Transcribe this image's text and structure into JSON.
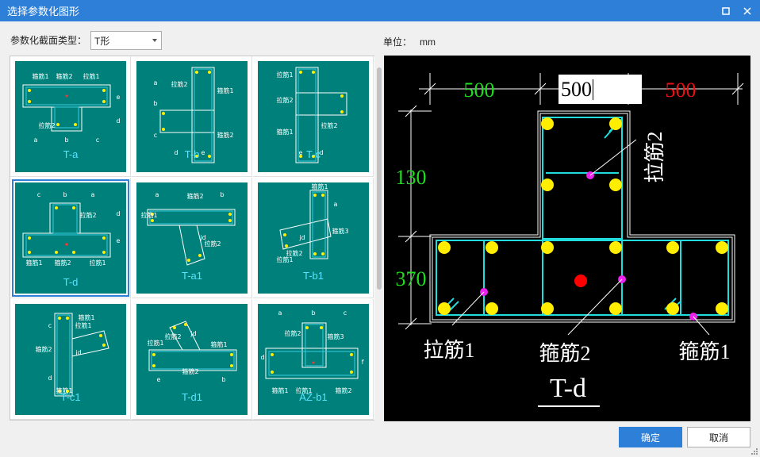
{
  "window": {
    "title": "选择参数化图形"
  },
  "controls": {
    "section_type_label": "参数化截面类型：",
    "section_type_value": "T形",
    "unit_label": "单位：",
    "unit_value": "mm"
  },
  "gallery": {
    "items": [
      {
        "label": "T-a"
      },
      {
        "label": "T-b"
      },
      {
        "label": "T-c"
      },
      {
        "label": "T-d"
      },
      {
        "label": "T-a1"
      },
      {
        "label": "T-b1"
      },
      {
        "label": "T-c1"
      },
      {
        "label": "T-d1"
      },
      {
        "label": "AZ-b1"
      }
    ],
    "selected": "T-d",
    "thumb_text": {
      "gujin1": "箍筋1",
      "gujin2": "箍筋2",
      "lajin1": "拉筋1",
      "lajin2": "拉筋2",
      "gujin3": "箍筋3",
      "jd": "jd",
      "a": "a",
      "b": "b",
      "c": "c",
      "d": "d",
      "e": "e",
      "f": "f"
    }
  },
  "preview": {
    "dim_left": "500",
    "dim_input": "500",
    "dim_right": "500",
    "dim_top": "130",
    "dim_bottom": "370",
    "label_lajin2": "拉筋2",
    "label_lajin1": "拉筋1",
    "label_gujin2": "箍筋2",
    "label_gujin1": "箍筋1",
    "name": "T-d",
    "colors": {
      "dim_green": "#22dd22",
      "dim_red": "#ee1111",
      "rebar": "#ffee00",
      "stirrup": "#22dddd",
      "tie": "#ee22ee",
      "center": "#ff0000"
    }
  },
  "buttons": {
    "ok": "确定",
    "cancel": "取消"
  }
}
